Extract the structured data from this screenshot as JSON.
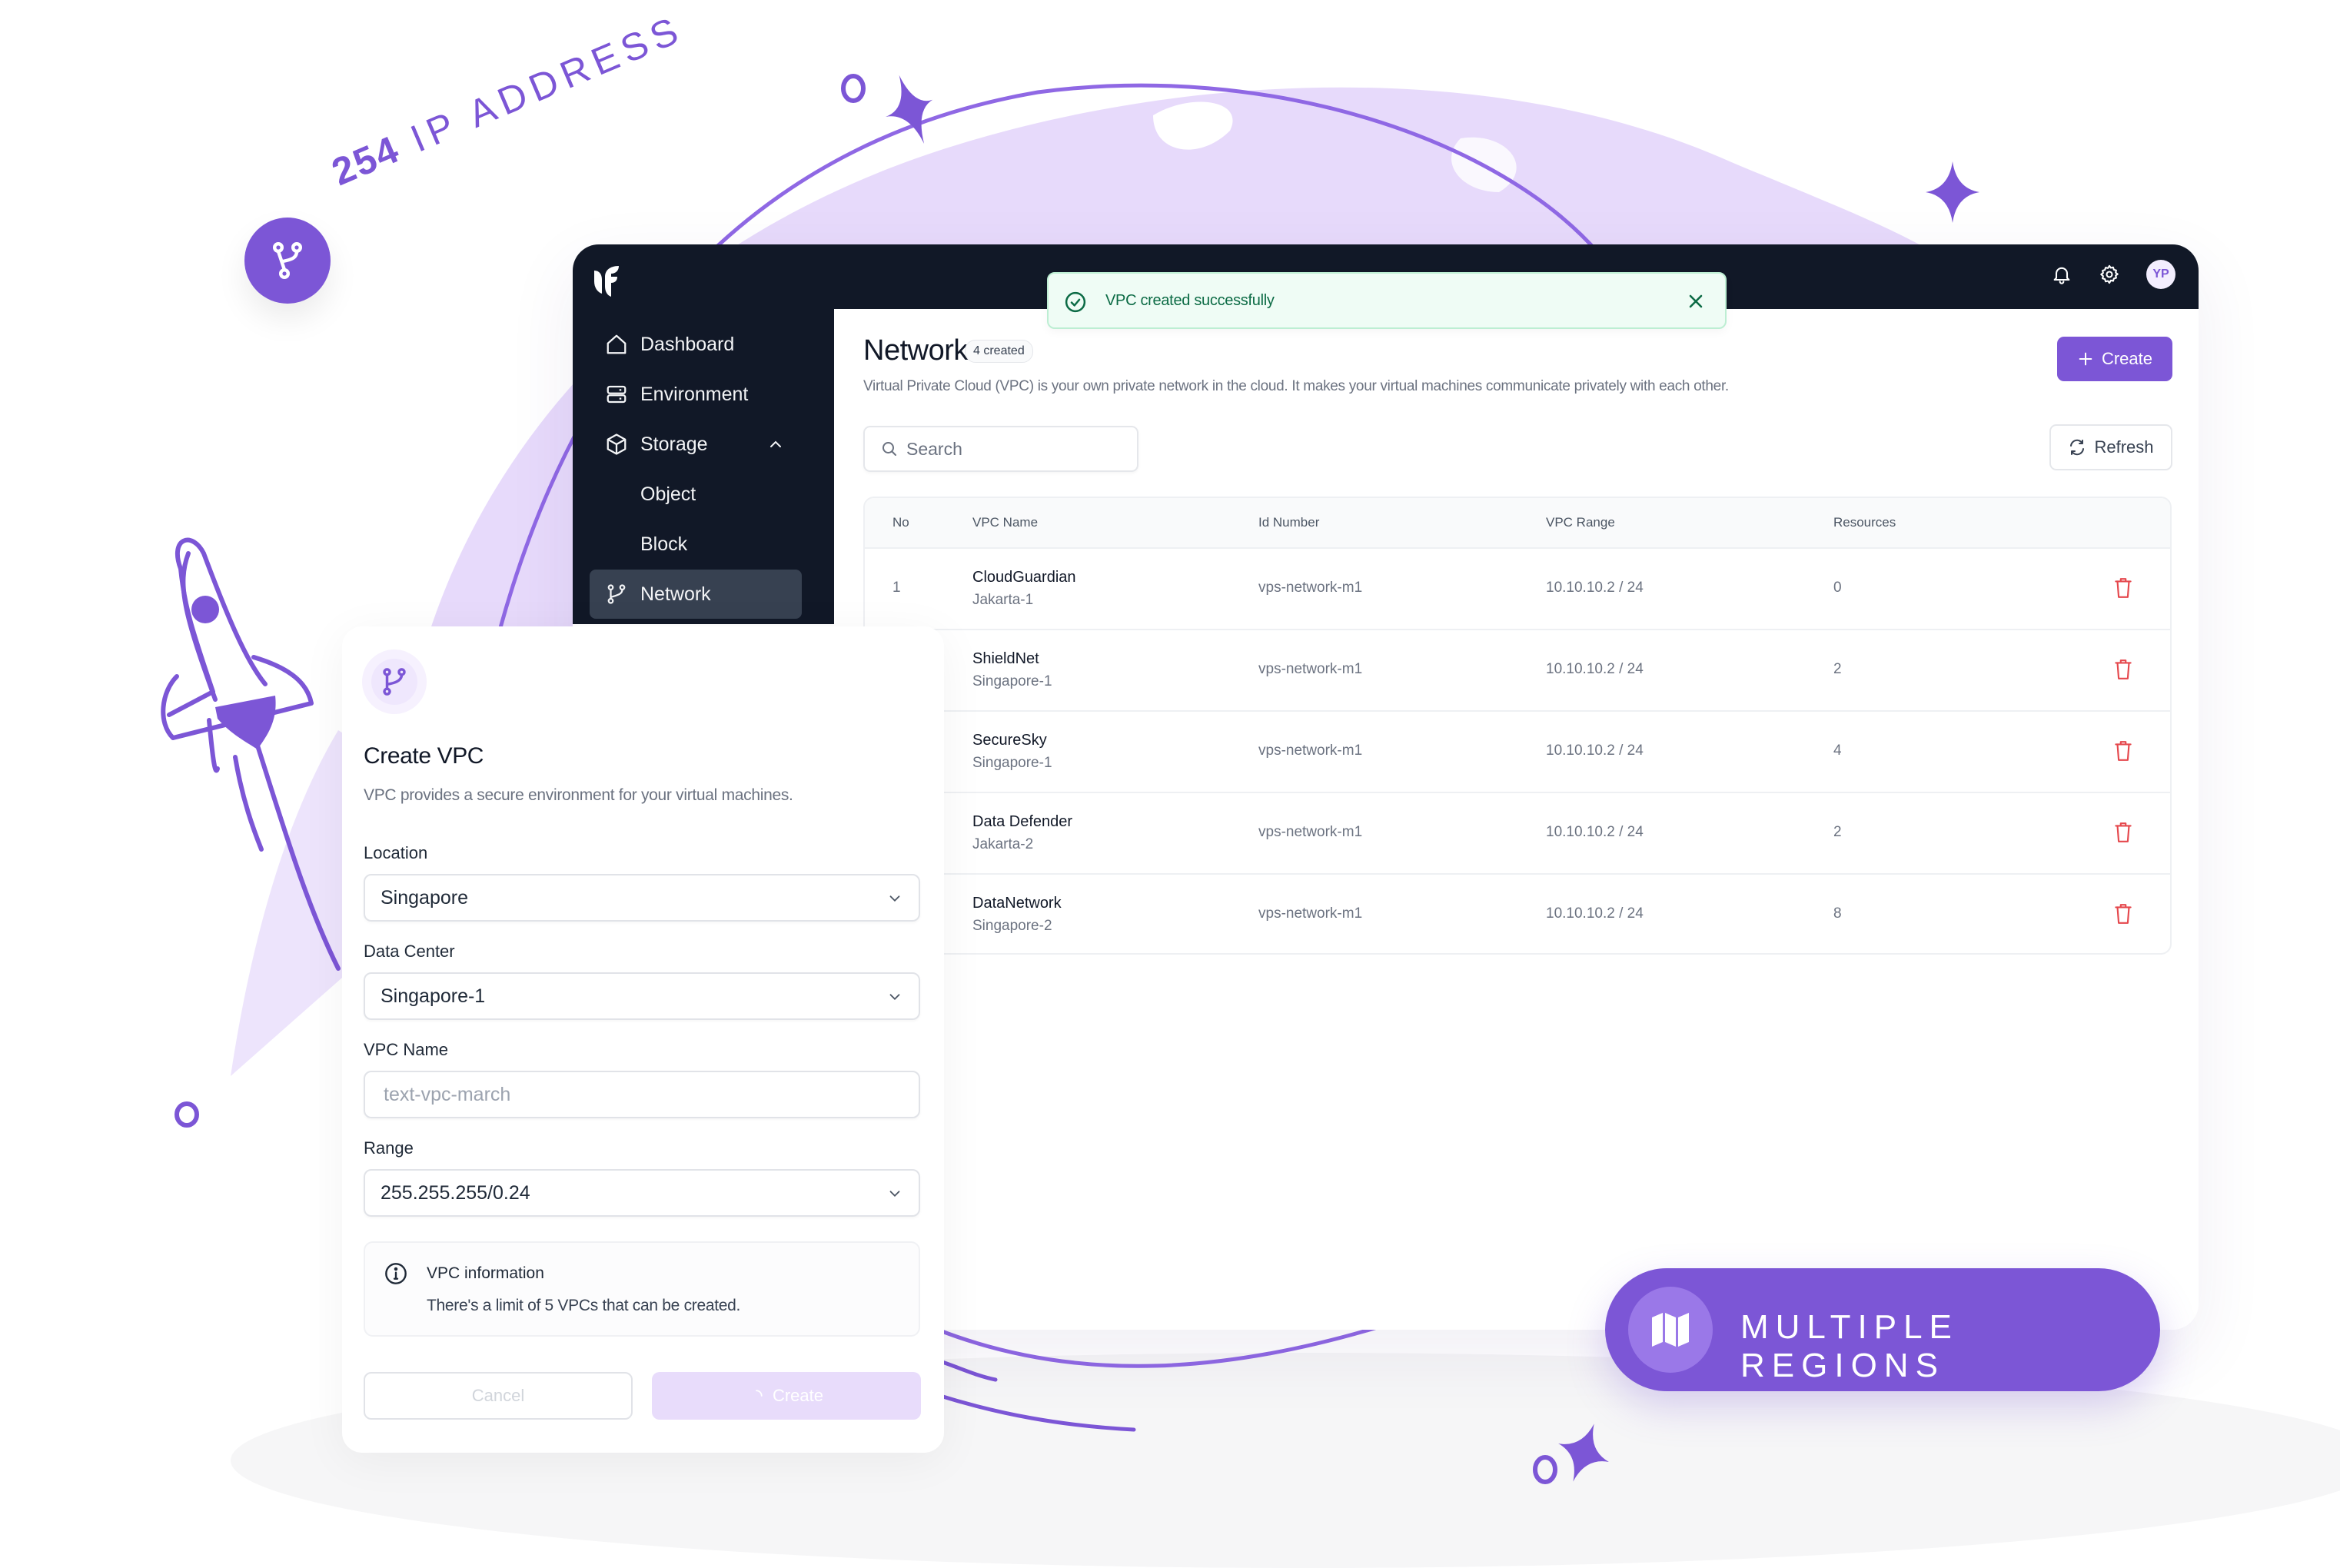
{
  "colors": {
    "accent": "#7c56d6",
    "accent_light": "#e8dcfb",
    "globe": "#e6d8fb",
    "header_bg": "#111827",
    "sidebar_active": "#374151",
    "success_bg": "#effcf5",
    "success_text": "#0c6b45",
    "danger": "#e5484d"
  },
  "promo": {
    "ip_count": "254",
    "ip_label": "IP ADDRESS",
    "regions_label": "MULTIPLE REGIONS"
  },
  "header": {
    "avatar_initials": "YP",
    "icons": [
      "bell-icon",
      "gear-icon"
    ]
  },
  "toast": {
    "message": "VPC created successfully"
  },
  "sidebar": {
    "items": [
      {
        "label": "Dashboard",
        "icon": "home-icon"
      },
      {
        "label": "Environment",
        "icon": "server-icon"
      },
      {
        "label": "Storage",
        "icon": "cube-icon",
        "expanded": true
      },
      {
        "label": "Object",
        "icon": ""
      },
      {
        "label": "Block",
        "icon": ""
      },
      {
        "label": "Network",
        "icon": "branch-icon",
        "active": true
      }
    ]
  },
  "page": {
    "title": "Network",
    "badge": "4 created",
    "description": "Virtual Private Cloud (VPC) is your own private network in the cloud. It makes your virtual machines communicate privately with each other.",
    "create_label": "Create",
    "refresh_label": "Refresh",
    "search_placeholder": "Search"
  },
  "table": {
    "columns": [
      "No",
      "VPC Name",
      "Id Number",
      "VPC Range",
      "Resources"
    ],
    "rows": [
      {
        "no": "1",
        "name": "CloudGuardian",
        "region": "Jakarta-1",
        "id": "vps-network-m1",
        "range": "10.10.10.2 / 24",
        "resources": "0"
      },
      {
        "no": "",
        "name": "ShieldNet",
        "region": "Singapore-1",
        "id": "vps-network-m1",
        "range": "10.10.10.2 / 24",
        "resources": "2"
      },
      {
        "no": "",
        "name": "SecureSky",
        "region": "Singapore-1",
        "id": "vps-network-m1",
        "range": "10.10.10.2 / 24",
        "resources": "4"
      },
      {
        "no": "",
        "name": "Data Defender",
        "region": "Jakarta-2",
        "id": "vps-network-m1",
        "range": "10.10.10.2 / 24",
        "resources": "2"
      },
      {
        "no": "",
        "name": "DataNetwork",
        "region": "Singapore-2",
        "id": "vps-network-m1",
        "range": "10.10.10.2 / 24",
        "resources": "8"
      }
    ]
  },
  "create_vpc": {
    "title": "Create VPC",
    "description": "VPC provides a secure environment for your virtual machines.",
    "location_label": "Location",
    "location_value": "Singapore",
    "datacenter_label": "Data Center",
    "datacenter_value": "Singapore-1",
    "name_label": "VPC Name",
    "name_placeholder": "text-vpc-march",
    "range_label": "Range",
    "range_value": "255.255.255/0.24",
    "info_title": "VPC information",
    "info_text": "There's a limit of 5 VPCs that can be created.",
    "cancel_label": "Cancel",
    "create_label": "Create"
  }
}
